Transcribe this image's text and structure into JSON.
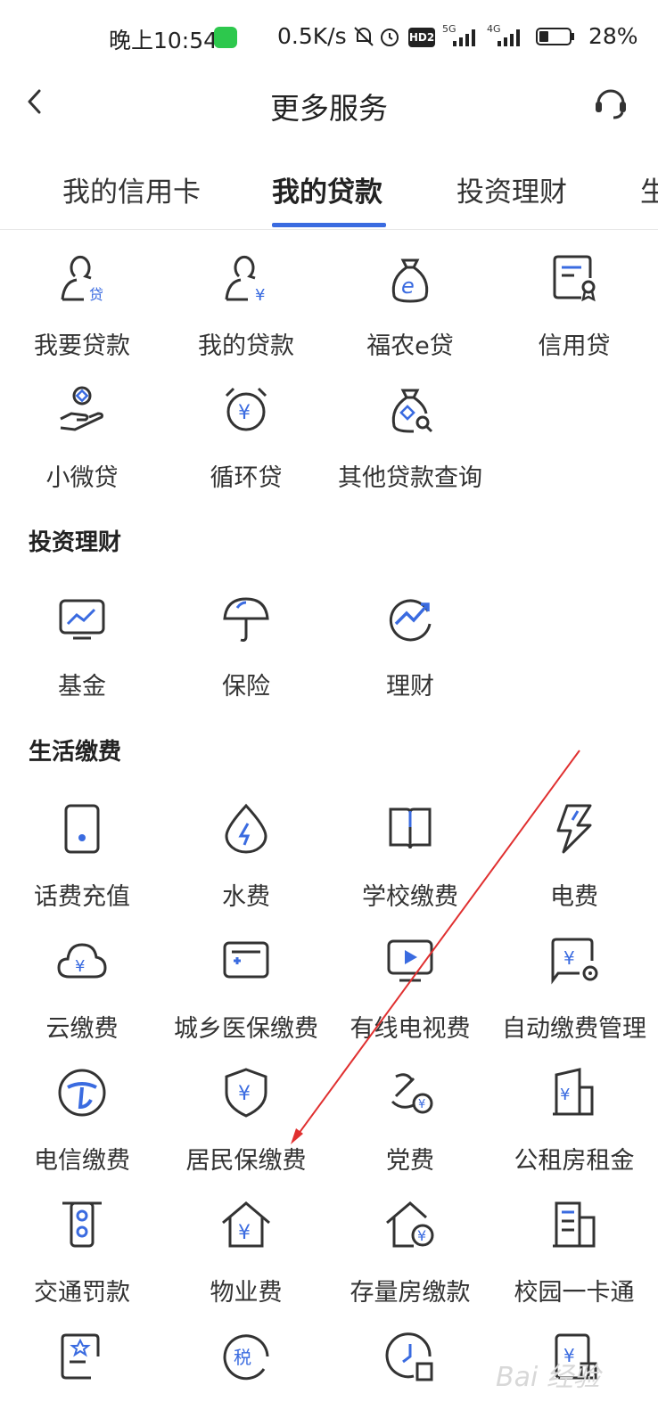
{
  "status_bar": {
    "time": "晚上10:54",
    "speed": "0.5K/s",
    "hd": "HD2",
    "net1": "5G",
    "net2": "4G",
    "battery": "28%"
  },
  "nav": {
    "title": "更多服务"
  },
  "tabs": [
    {
      "label": "我的信用卡"
    },
    {
      "label": "我的贷款"
    },
    {
      "label": "投资理财"
    },
    {
      "label": "生"
    }
  ],
  "loans": [
    {
      "label": "我要贷款",
      "icon": "loan-apply-icon"
    },
    {
      "label": "我的贷款",
      "icon": "my-loan-icon"
    },
    {
      "label": "福农e贷",
      "icon": "money-bag-e-icon"
    },
    {
      "label": "信用贷",
      "icon": "certificate-icon"
    },
    {
      "label": "小微贷",
      "icon": "hand-coin-icon"
    },
    {
      "label": "循环贷",
      "icon": "alarm-yuan-icon"
    },
    {
      "label": "其他贷款查询",
      "icon": "money-bag-search-icon"
    }
  ],
  "invest": {
    "title": "投资理财",
    "items": [
      {
        "label": "基金",
        "icon": "fund-chart-icon"
      },
      {
        "label": "保险",
        "icon": "umbrella-icon"
      },
      {
        "label": "理财",
        "icon": "trend-icon"
      }
    ]
  },
  "life": {
    "title": "生活缴费",
    "items": [
      {
        "label": "话费充值",
        "icon": "phone-icon"
      },
      {
        "label": "水费",
        "icon": "water-drop-icon"
      },
      {
        "label": "学校缴费",
        "icon": "book-icon"
      },
      {
        "label": "电费",
        "icon": "lightning-icon"
      },
      {
        "label": "云缴费",
        "icon": "cloud-yuan-icon"
      },
      {
        "label": "城乡医保缴费",
        "icon": "medical-card-icon"
      },
      {
        "label": "有线电视费",
        "icon": "tv-icon"
      },
      {
        "label": "自动缴费管理",
        "icon": "auto-pay-icon"
      },
      {
        "label": "电信缴费",
        "icon": "telecom-icon"
      },
      {
        "label": "居民保缴费",
        "icon": "shield-yuan-icon"
      },
      {
        "label": "党费",
        "icon": "party-emblem-icon"
      },
      {
        "label": "公租房租金",
        "icon": "building-yuan-icon"
      },
      {
        "label": "交通罚款",
        "icon": "traffic-light-icon"
      },
      {
        "label": "物业费",
        "icon": "house-yuan-icon"
      },
      {
        "label": "存量房缴款",
        "icon": "house-coin-icon"
      },
      {
        "label": "校园一卡通",
        "icon": "campus-building-icon"
      },
      {
        "label": "",
        "icon": "document-star-icon"
      },
      {
        "label": "",
        "icon": "tax-icon"
      },
      {
        "label": "",
        "icon": "clock-building-icon"
      },
      {
        "label": "",
        "icon": "yuan-receipt-icon"
      }
    ]
  },
  "watermark": "Bai 经验",
  "colors": {
    "accent": "#3a6be0",
    "icon_stroke": "#333333",
    "annotation_arrow": "#e03030"
  }
}
